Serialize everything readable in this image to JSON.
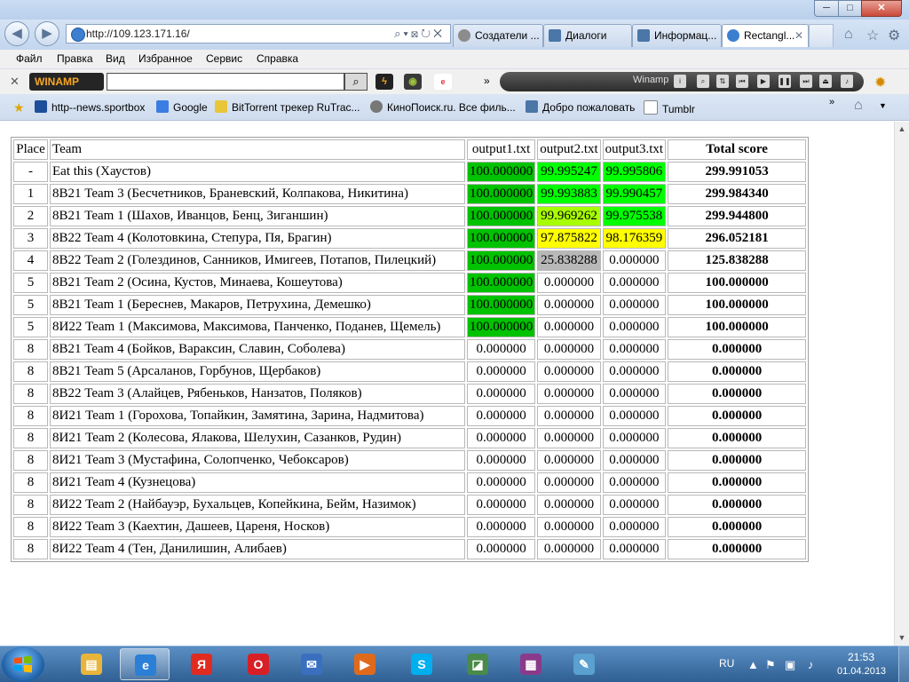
{
  "browser": {
    "window_controls": {
      "minimize": "─",
      "maximize": "□",
      "close": "✕"
    },
    "address_url": "http://109.123.171.16/",
    "address_tools": "⌕▾⊠↻✕",
    "tabs": [
      {
        "label": "Создатели ..."
      },
      {
        "label": "Диалоги"
      },
      {
        "label": "Информац..."
      },
      {
        "label": "Rectangl...",
        "close": "✕"
      }
    ],
    "menu": [
      "Файл",
      "Правка",
      "Вид",
      "Избранное",
      "Сервис",
      "Справка"
    ],
    "winamp": {
      "logo": "WINAMP",
      "player_label": "Winamp",
      "search_value": ""
    },
    "favorites": [
      {
        "label": "http--news.sportbox"
      },
      {
        "label": "Google"
      },
      {
        "label": "BitTorrent трекер RuTrac..."
      },
      {
        "label": "КиноПоиск.ru. Все филь..."
      },
      {
        "label": "Добро пожаловать"
      },
      {
        "label": "Tumblr"
      }
    ]
  },
  "table": {
    "headers": {
      "place": "Place",
      "team": "Team",
      "out1": "output1.txt",
      "out2": "output2.txt",
      "out3": "output3.txt",
      "total": "Total score"
    },
    "rows": [
      {
        "place": "-",
        "team": "Eat this (Хаустов)",
        "o1": "100.000000",
        "o2": "99.995247",
        "o3": "99.995806",
        "total": "299.991053",
        "c1": "#00c200",
        "c2": "#00ff00",
        "c3": "#00ff00"
      },
      {
        "place": "1",
        "team": "8В21 Team 3 (Бесчетников, Браневский, Колпакова, Никитина)",
        "o1": "100.000000",
        "o2": "99.993883",
        "o3": "99.990457",
        "total": "299.984340",
        "c1": "#00c200",
        "c2": "#00ff00",
        "c3": "#00ff00"
      },
      {
        "place": "2",
        "team": "8В21 Team 1 (Шахов, Иванцов, Бенц, Зиганшин)",
        "o1": "100.000000",
        "o2": "99.969262",
        "o3": "99.975538",
        "total": "299.944800",
        "c1": "#00c200",
        "c2": "#a8ff00",
        "c3": "#00ff00"
      },
      {
        "place": "3",
        "team": "8В22 Team 4 (Колотовкина, Степура, Пя, Брагин)",
        "o1": "100.000000",
        "o2": "97.875822",
        "o3": "98.176359",
        "total": "296.052181",
        "c1": "#00c200",
        "c2": "#ffff00",
        "c3": "#ffff00"
      },
      {
        "place": "4",
        "team": "8В22 Team 2 (Голездинов, Санников, Имигеев, Потапов, Пилецкий)",
        "o1": "100.000000",
        "o2": "25.838288",
        "o3": "0.000000",
        "total": "125.838288",
        "c1": "#00c200",
        "c2": "#b8b8b8",
        "c3": "#ffffff"
      },
      {
        "place": "5",
        "team": "8В21 Team 2 (Осина, Кустов, Минаева, Кошеутова)",
        "o1": "100.000000",
        "o2": "0.000000",
        "o3": "0.000000",
        "total": "100.000000",
        "c1": "#00c200",
        "c2": "#ffffff",
        "c3": "#ffffff"
      },
      {
        "place": "5",
        "team": "8В21 Team 1 (Береснев, Макаров, Петрухина, Демешко)",
        "o1": "100.000000",
        "o2": "0.000000",
        "o3": "0.000000",
        "total": "100.000000",
        "c1": "#00c200",
        "c2": "#ffffff",
        "c3": "#ffffff"
      },
      {
        "place": "5",
        "team": "8И22 Team 1 (Максимова, Максимова, Панченко, Поданев, Щемель)",
        "o1": "100.000000",
        "o2": "0.000000",
        "o3": "0.000000",
        "total": "100.000000",
        "c1": "#00c200",
        "c2": "#ffffff",
        "c3": "#ffffff"
      },
      {
        "place": "8",
        "team": "8В21 Team 4 (Бойков, Вараксин, Славин, Соболева)",
        "o1": "0.000000",
        "o2": "0.000000",
        "o3": "0.000000",
        "total": "0.000000",
        "c1": "#ffffff",
        "c2": "#ffffff",
        "c3": "#ffffff"
      },
      {
        "place": "8",
        "team": "8В21 Team 5 (Арсаланов, Горбунов, Щербаков)",
        "o1": "0.000000",
        "o2": "0.000000",
        "o3": "0.000000",
        "total": "0.000000",
        "c1": "#ffffff",
        "c2": "#ffffff",
        "c3": "#ffffff"
      },
      {
        "place": "8",
        "team": "8В22 Team 3 (Алайцев, Рябеньков, Нанзатов, Поляков)",
        "o1": "0.000000",
        "o2": "0.000000",
        "o3": "0.000000",
        "total": "0.000000",
        "c1": "#ffffff",
        "c2": "#ffffff",
        "c3": "#ffffff"
      },
      {
        "place": "8",
        "team": "8И21 Team 1 (Горохова, Топайкин, Замятина, Зарина, Надмитова)",
        "o1": "0.000000",
        "o2": "0.000000",
        "o3": "0.000000",
        "total": "0.000000",
        "c1": "#ffffff",
        "c2": "#ffffff",
        "c3": "#ffffff"
      },
      {
        "place": "8",
        "team": "8И21 Team 2 (Колесова, Ялакова, Шелухин, Сазанков, Рудин)",
        "o1": "0.000000",
        "o2": "0.000000",
        "o3": "0.000000",
        "total": "0.000000",
        "c1": "#ffffff",
        "c2": "#ffffff",
        "c3": "#ffffff"
      },
      {
        "place": "8",
        "team": "8И21 Team 3 (Мустафина, Солопченко, Чебоксаров)",
        "o1": "0.000000",
        "o2": "0.000000",
        "o3": "0.000000",
        "total": "0.000000",
        "c1": "#ffffff",
        "c2": "#ffffff",
        "c3": "#ffffff"
      },
      {
        "place": "8",
        "team": "8И21 Team 4 (Кузнецова)",
        "o1": "0.000000",
        "o2": "0.000000",
        "o3": "0.000000",
        "total": "0.000000",
        "c1": "#ffffff",
        "c2": "#ffffff",
        "c3": "#ffffff"
      },
      {
        "place": "8",
        "team": "8И22 Team 2 (Найбауэр, Бухальцев, Копейкина, Бейм, Назимок)",
        "o1": "0.000000",
        "o2": "0.000000",
        "o3": "0.000000",
        "total": "0.000000",
        "c1": "#ffffff",
        "c2": "#ffffff",
        "c3": "#ffffff"
      },
      {
        "place": "8",
        "team": "8И22 Team 3 (Каехтин, Дашеев, Царeня, Носков)",
        "o1": "0.000000",
        "o2": "0.000000",
        "o3": "0.000000",
        "total": "0.000000",
        "c1": "#ffffff",
        "c2": "#ffffff",
        "c3": "#ffffff"
      },
      {
        "place": "8",
        "team": "8И22 Team 4 (Тен, Данилишин, Алибаев)",
        "o1": "0.000000",
        "o2": "0.000000",
        "o3": "0.000000",
        "total": "0.000000",
        "c1": "#ffffff",
        "c2": "#ffffff",
        "c3": "#ffffff"
      }
    ]
  },
  "taskbar": {
    "apps": [
      {
        "name": "explorer",
        "glyph": "▤",
        "color": "#e8b53a"
      },
      {
        "name": "internet-explorer",
        "glyph": "e",
        "color": "#2b7fd6"
      },
      {
        "name": "yandex-browser",
        "glyph": "Я",
        "color": "#e02b20"
      },
      {
        "name": "opera",
        "glyph": "O",
        "color": "#d81f26"
      },
      {
        "name": "mail",
        "glyph": "✉",
        "color": "#3a6fc0"
      },
      {
        "name": "media-player",
        "glyph": "▶",
        "color": "#e06a1c"
      },
      {
        "name": "skype",
        "glyph": "S",
        "color": "#00aff0"
      },
      {
        "name": "image-viewer",
        "glyph": "◪",
        "color": "#4a8a4a"
      },
      {
        "name": "winrar",
        "glyph": "▦",
        "color": "#8a3a8a"
      },
      {
        "name": "notepad",
        "glyph": "✎",
        "color": "#5aa0d0"
      }
    ],
    "tray": {
      "language": "RU",
      "time": "21:53",
      "date": "01.04.2013"
    }
  }
}
